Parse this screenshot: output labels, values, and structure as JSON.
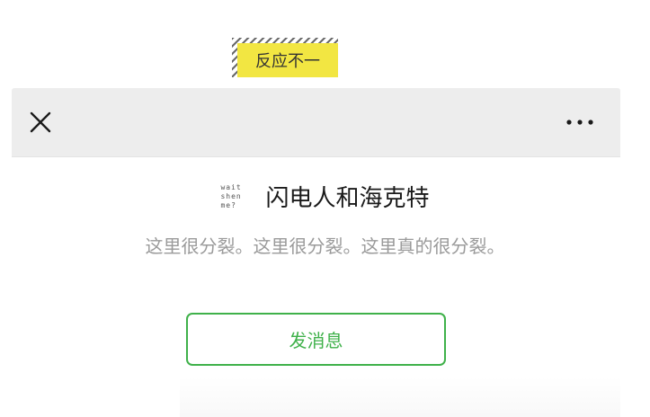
{
  "sticker": {
    "text": "反应不一",
    "color": "#f2e642"
  },
  "nav": {
    "close_icon": "close-icon",
    "more_icon": "more-horizontal-icon",
    "background": "#ededed"
  },
  "profile": {
    "avatar_text": "wait\nshen\nme?",
    "name": "闪电人和海克特",
    "signature": "这里很分裂。这里很分裂。这里真的很分裂。"
  },
  "actions": {
    "message_label": "发消息",
    "accent_color": "#3fb14a"
  }
}
